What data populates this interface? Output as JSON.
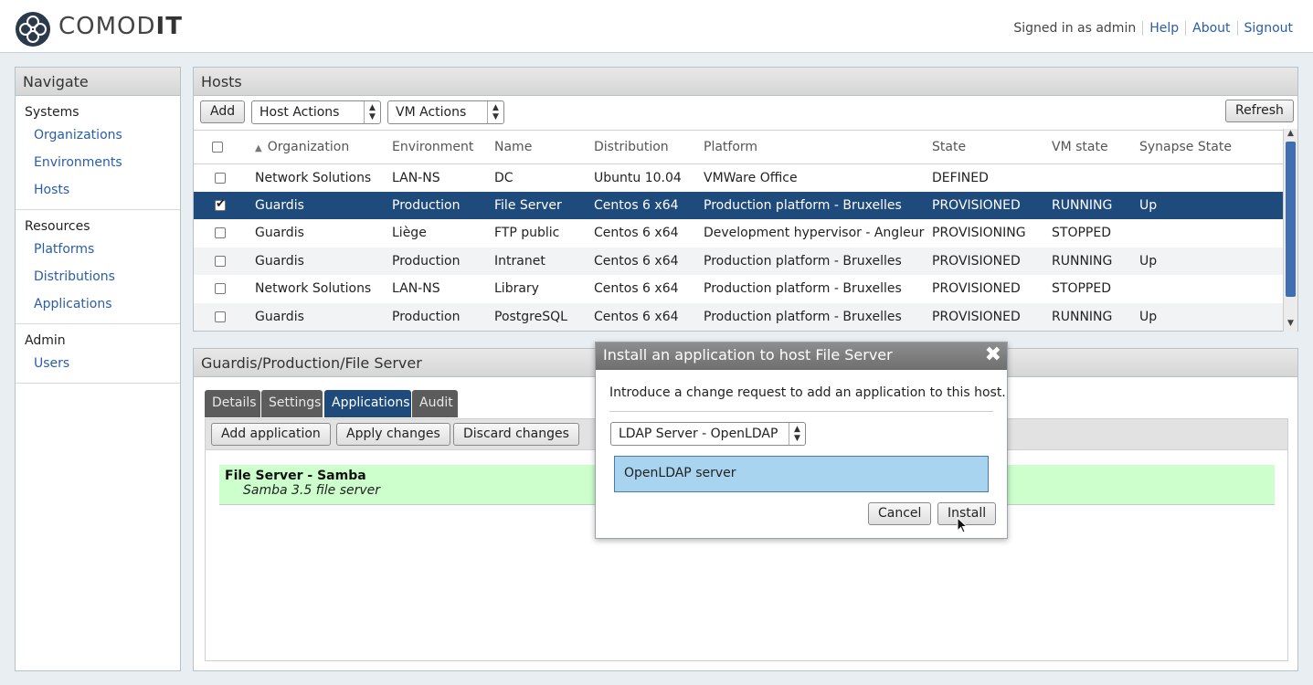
{
  "header": {
    "brand_light": "COMOD",
    "brand_bold": "IT",
    "signed_in": "Signed in as admin",
    "help": "Help",
    "about": "About",
    "signout": "Signout"
  },
  "nav": {
    "title": "Navigate",
    "sections": [
      {
        "head": "Systems",
        "items": [
          "Organizations",
          "Environments",
          "Hosts"
        ]
      },
      {
        "head": "Resources",
        "items": [
          "Platforms",
          "Distributions",
          "Applications"
        ]
      },
      {
        "head": "Admin",
        "items": [
          "Users"
        ]
      }
    ]
  },
  "hosts": {
    "title": "Hosts",
    "add_label": "Add",
    "host_actions": "Host Actions",
    "vm_actions": "VM Actions",
    "refresh_label": "Refresh",
    "columns": [
      "Organization",
      "Environment",
      "Name",
      "Distribution",
      "Platform",
      "State",
      "VM state",
      "Synapse State"
    ],
    "rows": [
      {
        "checked": false,
        "org": "Network Solutions",
        "env": "LAN-NS",
        "name": "DC",
        "dist": "Ubuntu 10.04",
        "platform": "VMWare Office",
        "state": "DEFINED",
        "vm": "",
        "syn": ""
      },
      {
        "checked": true,
        "org": "Guardis",
        "env": "Production",
        "name": "File Server",
        "dist": "Centos 6 x64",
        "platform": "Production platform - Bruxelles",
        "state": "PROVISIONED",
        "vm": "RUNNING",
        "syn": "Up"
      },
      {
        "checked": false,
        "org": "Guardis",
        "env": "Liège",
        "name": "FTP public",
        "dist": "Centos 6 x64",
        "platform": "Development hypervisor - Angleur",
        "state": "PROVISIONING",
        "vm": "STOPPED",
        "syn": ""
      },
      {
        "checked": false,
        "org": "Guardis",
        "env": "Production",
        "name": "Intranet",
        "dist": "Centos 6 x64",
        "platform": "Production platform - Bruxelles",
        "state": "PROVISIONED",
        "vm": "RUNNING",
        "syn": "Up"
      },
      {
        "checked": false,
        "org": "Network Solutions",
        "env": "LAN-NS",
        "name": "Library",
        "dist": "Centos 6 x64",
        "platform": "Production platform - Bruxelles",
        "state": "PROVISIONED",
        "vm": "STOPPED",
        "syn": ""
      },
      {
        "checked": false,
        "org": "Guardis",
        "env": "Production",
        "name": "PostgreSQL",
        "dist": "Centos 6 x64",
        "platform": "Production platform - Bruxelles",
        "state": "PROVISIONED",
        "vm": "RUNNING",
        "syn": "Up"
      }
    ]
  },
  "detail": {
    "title": "Guardis/Production/File Server",
    "tabs": [
      "Details",
      "Settings",
      "Applications",
      "Audit"
    ],
    "add_app": "Add application",
    "apply": "Apply changes",
    "discard": "Discard changes",
    "app_name": "File Server - Samba",
    "app_desc": "Samba 3.5 file server"
  },
  "modal": {
    "title": "Install an application to host File Server",
    "message": "Introduce a change request to add an application to this host.",
    "select_value": "LDAP Server - OpenLDAP",
    "option": "OpenLDAP server",
    "cancel": "Cancel",
    "install": "Install"
  },
  "colors": {
    "selected_row": "#1f4a7c",
    "link": "#2a5da8",
    "app_row_bg": "#ccffcc",
    "option_bg": "#a8d4f0"
  }
}
